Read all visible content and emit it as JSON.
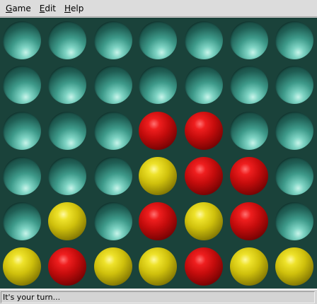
{
  "menubar": {
    "items": [
      {
        "label_mnemonic": "G",
        "label_rest": "ame"
      },
      {
        "label_mnemonic": "E",
        "label_rest": "dit"
      },
      {
        "label_mnemonic": "H",
        "label_rest": "elp"
      }
    ]
  },
  "board": {
    "rows": 6,
    "columns": 7,
    "colors": {
      "background": "#1a423a",
      "red": "#d81616",
      "yellow": "#dccd14",
      "empty": "#3e9a8a"
    },
    "cells": [
      [
        "empty",
        "empty",
        "empty",
        "empty",
        "empty",
        "empty",
        "empty"
      ],
      [
        "empty",
        "empty",
        "empty",
        "empty",
        "empty",
        "empty",
        "empty"
      ],
      [
        "empty",
        "empty",
        "empty",
        "red",
        "red",
        "empty",
        "empty"
      ],
      [
        "empty",
        "empty",
        "empty",
        "yellow",
        "red",
        "red",
        "empty"
      ],
      [
        "empty",
        "yellow",
        "empty",
        "red",
        "yellow",
        "red",
        "empty"
      ],
      [
        "yellow",
        "red",
        "yellow",
        "yellow",
        "red",
        "yellow",
        "yellow"
      ]
    ]
  },
  "status": {
    "text": "It's your turn..."
  }
}
